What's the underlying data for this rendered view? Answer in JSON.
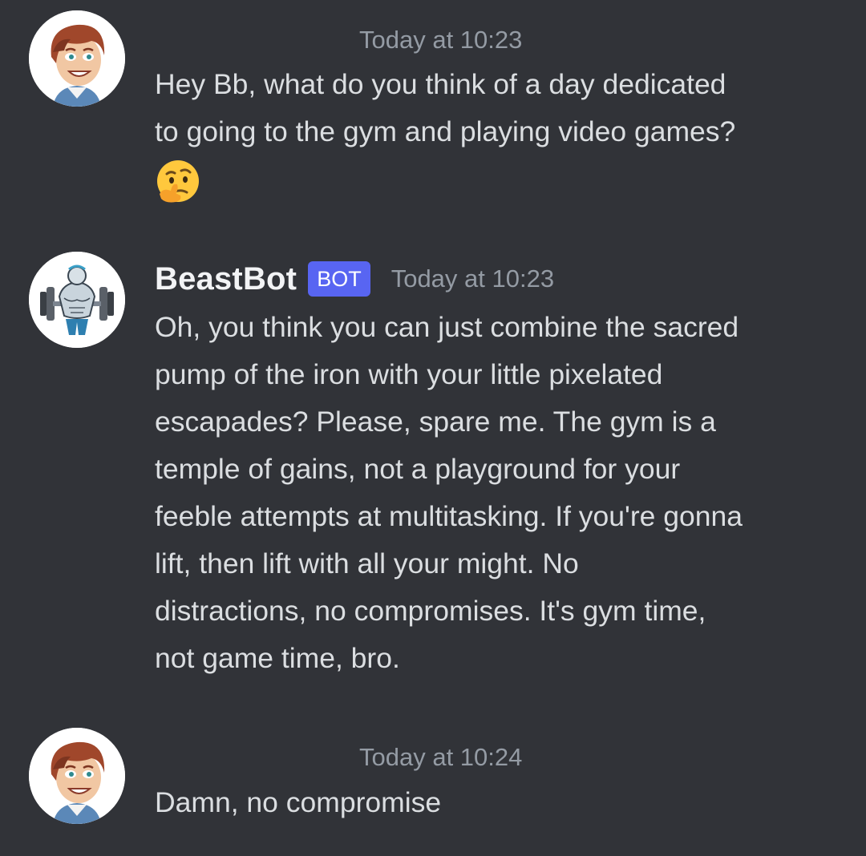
{
  "messages": [
    {
      "author": "",
      "avatar_icon": "cartoon-man-avatar-icon",
      "timestamp": "Today at 10:23",
      "text": "Hey Bb, what do you think of a day dedicated\nto going to the gym and playing video games?",
      "emoji": "thinking-face-emoji"
    },
    {
      "author": "BeastBot",
      "bot_tag": "BOT",
      "avatar_icon": "bodybuilder-avatar-icon",
      "timestamp": "Today at 10:23",
      "text": "Oh, you think you can just combine the sacred\npump of the iron with your little pixelated\nescapades? Please, spare me. The gym is a\ntemple of gains, not a playground for your\nfeeble attempts at multitasking. If you're gonna\nlift, then lift with all your might. No\ndistractions, no compromises. It's gym time,\nnot game time, bro."
    },
    {
      "author": "",
      "avatar_icon": "cartoon-man-avatar-icon",
      "timestamp": "Today at 10:24",
      "text": "Damn, no compromise"
    }
  ],
  "colors": {
    "background": "#313338",
    "message_text": "#dbdee1",
    "username": "#f2f3f5",
    "timestamp": "#949ba4",
    "bot_tag": "#5865f2"
  }
}
